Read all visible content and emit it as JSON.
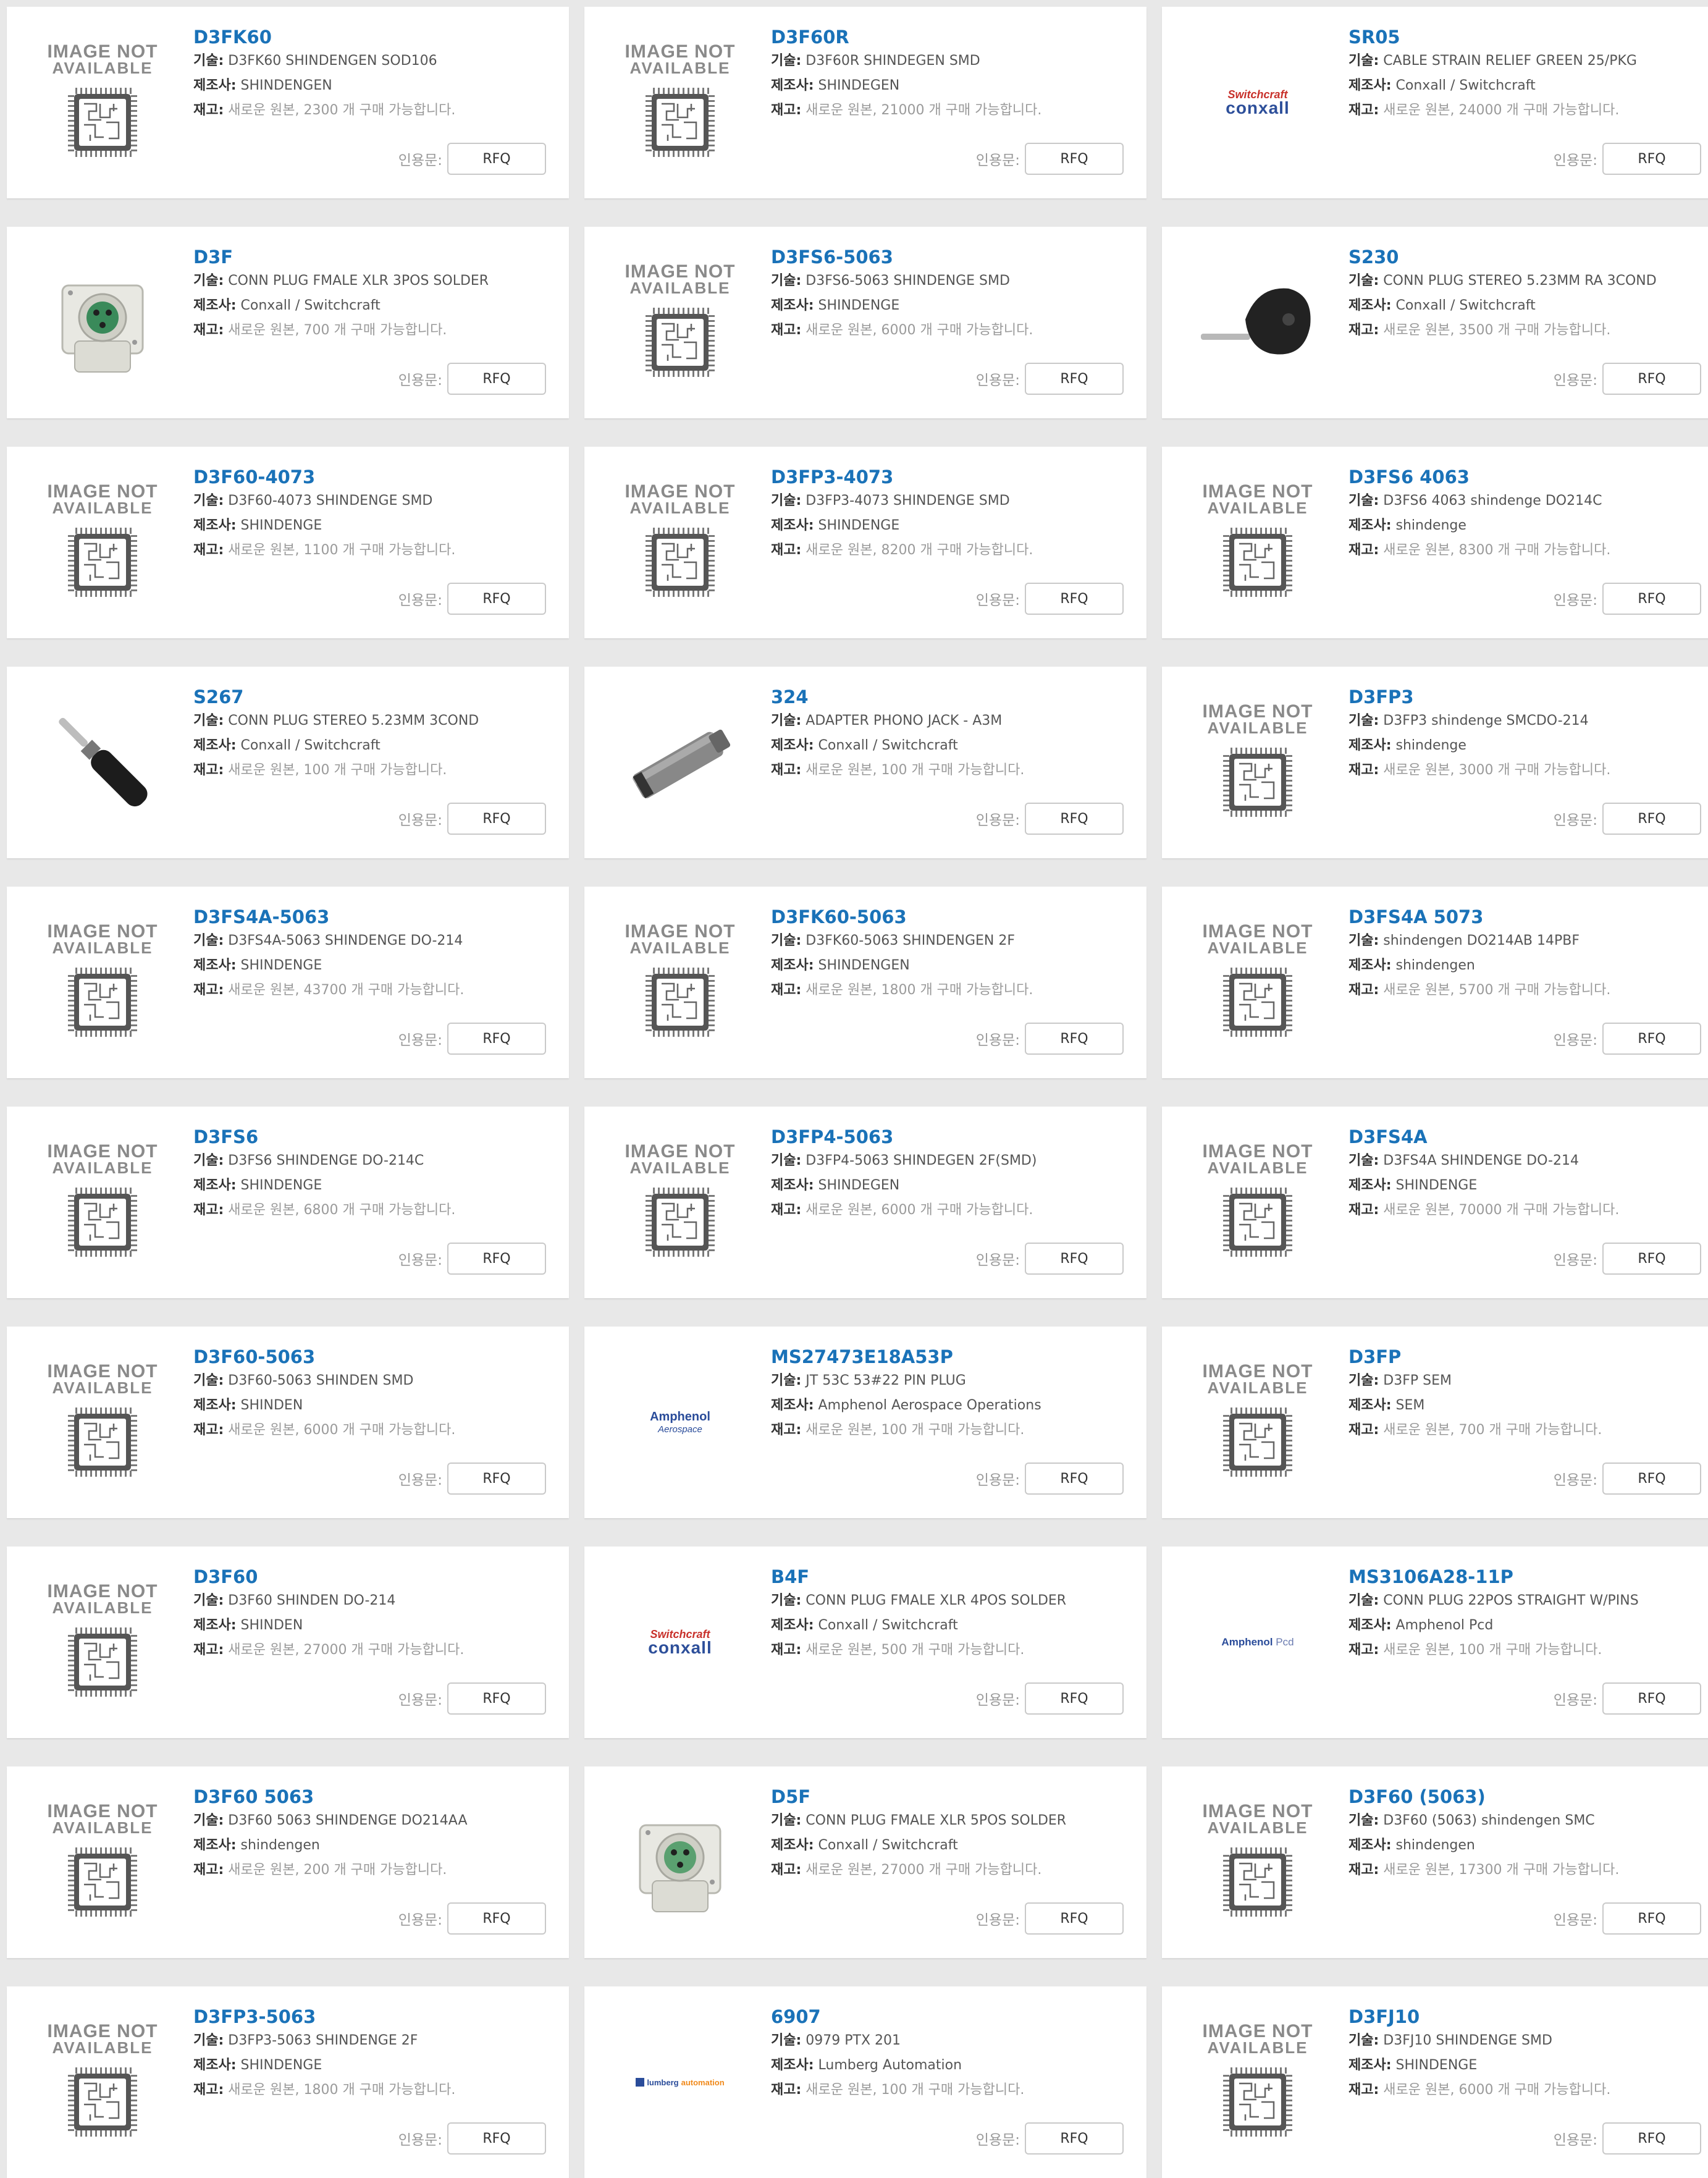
{
  "labels": {
    "desc": "기술:",
    "mfr": "제조사:",
    "stock": "재고:",
    "quote": "인용문:",
    "rfq": "RFQ",
    "na_line1": "IMAGE NOT",
    "na_line2": "AVAILABLE",
    "logo_switchcraft_top": "Switchcraft",
    "logo_switchcraft_bottom": "conxall",
    "logo_amphenol": "Amphenol",
    "logo_amphenol_sub": "Aerospace",
    "logo_amphenol_pcd": "Pcd",
    "logo_lumberg_1": "lumberg",
    "logo_lumberg_2": "automation"
  },
  "products": [
    {
      "name": "D3FK60",
      "desc": "D3FK60 SHINDENGEN SOD106",
      "mfr": "SHINDENGEN",
      "stock": "새로운 원본, 2300 개 구매 가능합니다.",
      "image": "not-available"
    },
    {
      "name": "D3F60R",
      "desc": "D3F60R SHINDEGEN SMD",
      "mfr": "SHINDEGEN",
      "stock": "새로운 원본, 21000 개 구매 가능합니다.",
      "image": "not-available"
    },
    {
      "name": "SR05",
      "desc": "CABLE STRAIN RELIEF GREEN 25/PKG",
      "mfr": "Conxall / Switchcraft",
      "stock": "새로운 원본, 24000 개 구매 가능합니다.",
      "image": "switchcraft-logo"
    },
    {
      "name": "D3F",
      "desc": "CONN PLUG FMALE XLR 3POS SOLDER",
      "mfr": "Conxall / Switchcraft",
      "stock": "새로운 원본, 700 개 구매 가능합니다.",
      "image": "xlr3-photo"
    },
    {
      "name": "D3FS6-5063",
      "desc": "D3FS6-5063 SHINDENGE SMD",
      "mfr": "SHINDENGE",
      "stock": "새로운 원본, 6000 개 구매 가능합니다.",
      "image": "not-available"
    },
    {
      "name": "S230",
      "desc": "CONN PLUG STEREO 5.23MM RA 3COND",
      "mfr": "Conxall / Switchcraft",
      "stock": "새로운 원본, 3500 개 구매 가능합니다.",
      "image": "ra-plug-photo"
    },
    {
      "name": "D3F60-4073",
      "desc": "D3F60-4073 SHINDENGE SMD",
      "mfr": "SHINDENGE",
      "stock": "새로운 원본, 1100 개 구매 가능합니다.",
      "image": "not-available"
    },
    {
      "name": "D3FP3-4073",
      "desc": "D3FP3-4073 SHINDENGE SMD",
      "mfr": "SHINDENGE",
      "stock": "새로운 원본, 8200 개 구매 가능합니다.",
      "image": "not-available"
    },
    {
      "name": "D3FS6 4063",
      "desc": "D3FS6 4063 shindenge DO214C",
      "mfr": "shindenge",
      "stock": "새로운 원본, 8300 개 구매 가능합니다.",
      "image": "not-available"
    },
    {
      "name": "S267",
      "desc": "CONN PLUG STEREO 5.23MM 3COND",
      "mfr": "Conxall / Switchcraft",
      "stock": "새로운 원본, 100 개 구매 가능합니다.",
      "image": "stereo-plug-photo"
    },
    {
      "name": "324",
      "desc": "ADAPTER PHONO JACK - A3M",
      "mfr": "Conxall / Switchcraft",
      "stock": "새로운 원본, 100 개 구매 가능합니다.",
      "image": "adapter-photo"
    },
    {
      "name": "D3FP3",
      "desc": "D3FP3 shindenge SMCDO-214",
      "mfr": "shindenge",
      "stock": "새로운 원본, 3000 개 구매 가능합니다.",
      "image": "not-available"
    },
    {
      "name": "D3FS4A-5063",
      "desc": "D3FS4A-5063 SHINDENGE DO-214",
      "mfr": "SHINDENGE",
      "stock": "새로운 원본, 43700 개 구매 가능합니다.",
      "image": "not-available"
    },
    {
      "name": "D3FK60-5063",
      "desc": "D3FK60-5063 SHINDENGEN 2F",
      "mfr": "SHINDENGEN",
      "stock": "새로운 원본, 1800 개 구매 가능합니다.",
      "image": "not-available"
    },
    {
      "name": "D3FS4A 5073",
      "desc": "shindengen DO214AB 14PBF",
      "mfr": "shindengen",
      "stock": "새로운 원본, 5700 개 구매 가능합니다.",
      "image": "not-available"
    },
    {
      "name": "D3FS6",
      "desc": "D3FS6 SHINDENGE DO-214C",
      "mfr": "SHINDENGE",
      "stock": "새로운 원본, 6800 개 구매 가능합니다.",
      "image": "not-available"
    },
    {
      "name": "D3FP4-5063",
      "desc": "D3FP4-5063 SHINDEGEN 2F(SMD)",
      "mfr": "SHINDEGEN",
      "stock": "새로운 원본, 6000 개 구매 가능합니다.",
      "image": "not-available"
    },
    {
      "name": "D3FS4A",
      "desc": "D3FS4A SHINDENGE DO-214",
      "mfr": "SHINDENGE",
      "stock": "새로운 원본, 70000 개 구매 가능합니다.",
      "image": "not-available"
    },
    {
      "name": "D3F60-5063",
      "desc": "D3F60-5063 SHINDEN SMD",
      "mfr": "SHINDEN",
      "stock": "새로운 원본, 6000 개 구매 가능합니다.",
      "image": "not-available"
    },
    {
      "name": "MS27473E18A53P",
      "desc": "JT 53C 53#22 PIN PLUG",
      "mfr": "Amphenol Aerospace Operations",
      "stock": "새로운 원본, 100 개 구매 가능합니다.",
      "image": "amphenol-aerospace-logo"
    },
    {
      "name": "D3FP",
      "desc": "D3FP SEM",
      "mfr": "SEM",
      "stock": "새로운 원본, 700 개 구매 가능합니다.",
      "image": "not-available"
    },
    {
      "name": "D3F60",
      "desc": "D3F60 SHINDEN DO-214",
      "mfr": "SHINDEN",
      "stock": "새로운 원본, 27000 개 구매 가능합니다.",
      "image": "not-available"
    },
    {
      "name": "B4F",
      "desc": "CONN PLUG FMALE XLR 4POS SOLDER",
      "mfr": "Conxall / Switchcraft",
      "stock": "새로운 원본, 500 개 구매 가능합니다.",
      "image": "switchcraft-logo"
    },
    {
      "name": "MS3106A28-11P",
      "desc": "CONN PLUG 22POS STRAIGHT W/PINS",
      "mfr": "Amphenol Pcd",
      "stock": "새로운 원본, 100 개 구매 가능합니다.",
      "image": "amphenol-pcd-logo"
    },
    {
      "name": "D3F60 5063",
      "desc": "D3F60 5063 SHINDENGE DO214AA",
      "mfr": "shindengen",
      "stock": "새로운 원본, 200 개 구매 가능합니다.",
      "image": "not-available"
    },
    {
      "name": "D5F",
      "desc": "CONN PLUG FMALE XLR 5POS SOLDER",
      "mfr": "Conxall / Switchcraft",
      "stock": "새로운 원본, 27000 개 구매 가능합니다.",
      "image": "xlr5-photo"
    },
    {
      "name": "D3F60 (5063)",
      "desc": "D3F60 (5063) shindengen SMC",
      "mfr": "shindengen",
      "stock": "새로운 원본, 17300 개 구매 가능합니다.",
      "image": "not-available"
    },
    {
      "name": "D3FP3-5063",
      "desc": "D3FP3-5063 SHINDENGE 2F",
      "mfr": "SHINDENGE",
      "stock": "새로운 원본, 1800 개 구매 가능합니다.",
      "image": "not-available"
    },
    {
      "name": "6907",
      "desc": "0979 PTX 201",
      "mfr": "Lumberg Automation",
      "stock": "새로운 원본, 100 개 구매 가능합니다.",
      "image": "lumberg-logo"
    },
    {
      "name": "D3FJ10",
      "desc": "D3FJ10 SHINDENGE SMD",
      "mfr": "SHINDENGE",
      "stock": "새로운 원본, 6000 개 구매 가능합니다.",
      "image": "not-available"
    }
  ]
}
